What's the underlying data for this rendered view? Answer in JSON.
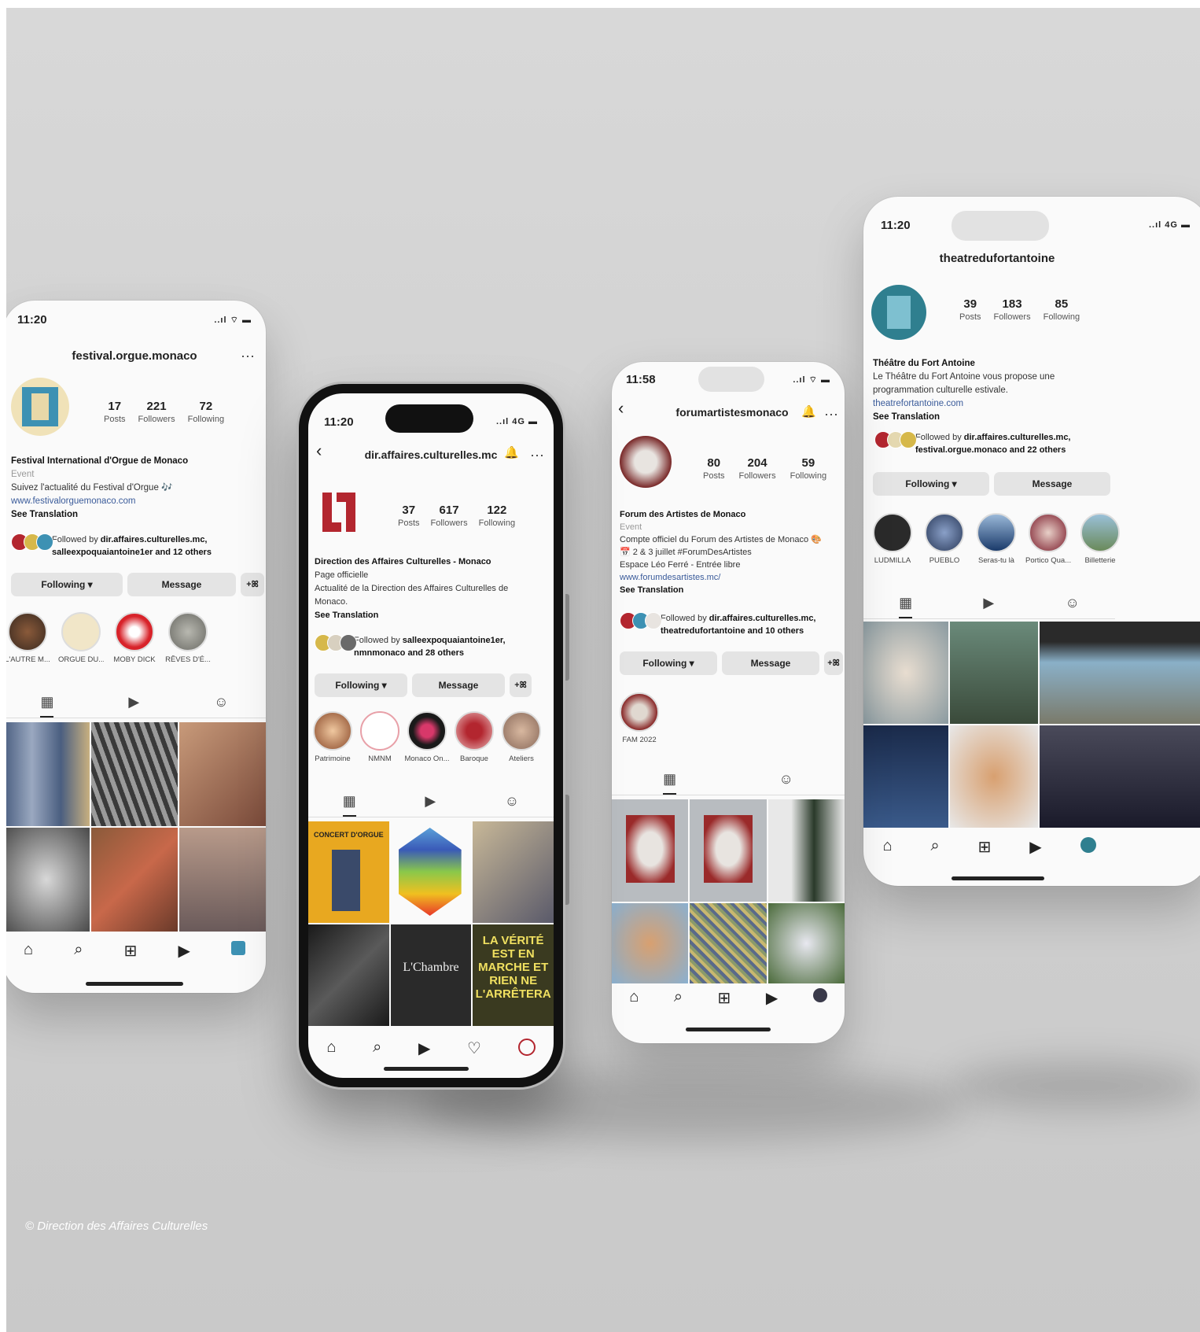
{
  "phones": [
    {
      "time": "11:20",
      "signal": "..ıl ⌔ ▬",
      "username": "festival.orgue.monaco",
      "menu": "···",
      "posts": "17",
      "followers": "221",
      "following": "72",
      "posts_label": "Posts",
      "followers_label": "Followers",
      "following_label": "Following",
      "name": "Festival International d'Orgue de Monaco",
      "category": "Event",
      "bio": "Suivez l'actualité du Festival d'Orgue 🎶",
      "link": "www.festivalorguemonaco.com",
      "see_translation": "See Translation",
      "followed_prefix": "Followed by ",
      "followed_names": "dir.affaires.culturelles.mc,",
      "followed_rest": "salleexpoquaiantoine1er and 12 others",
      "following_btn": "Following ▾",
      "message_btn": "Message",
      "add_btn": "+ꕤ",
      "highlights": [
        "L'AUTRE M...",
        "ORGUE DU...",
        "MOBY DICK",
        "RÊVES D'É..."
      ]
    },
    {
      "time": "11:20",
      "signal": "..ıl 4G ▬",
      "username": "dir.affaires.culturelles.mc",
      "back": "‹",
      "bell": "🔔",
      "menu": "···",
      "posts": "37",
      "followers": "617",
      "following": "122",
      "posts_label": "Posts",
      "followers_label": "Followers",
      "following_label": "Following",
      "name": "Direction des Affaires Culturelles - Monaco",
      "category": "Page officielle",
      "bio": "Actualité de la Direction des Affaires Culturelles de Monaco.",
      "see_translation": "See Translation",
      "followed_prefix": "Followed by ",
      "followed_names": "salleexpoquaiantoine1er,",
      "followed_rest": "nmnmonaco and 28 others",
      "following_btn": "Following ▾",
      "message_btn": "Message",
      "add_btn": "+ꕤ",
      "highlights": [
        "Patrimoine",
        "NMNM",
        "Monaco On...",
        "Baroque",
        "Ateliers"
      ],
      "post_texts": [
        "CONCERT D'ORGUE",
        "L'Chambre",
        "LA VÉRITÉ EST EN MARCHE ET RIEN NE L'ARRÊTERA"
      ]
    },
    {
      "time": "11:58",
      "signal": "..ıl ⌔ ▬",
      "username": "forumartistesmonaco",
      "back": "‹",
      "bell": "🔔",
      "menu": "···",
      "posts": "80",
      "followers": "204",
      "following": "59",
      "posts_label": "Posts",
      "followers_label": "Followers",
      "following_label": "Following",
      "name": "Forum des Artistes de Monaco",
      "category": "Event",
      "bio1": "Compte officiel du Forum des Artistes de Monaco 🎨",
      "bio2": "📅 2 & 3 juillet #ForumDesArtistes",
      "bio3": "Espace Léo Ferré - Entrée libre",
      "link": "www.forumdesartistes.mc/",
      "see_translation": "See Translation",
      "followed_prefix": "Followed by ",
      "followed_names": "dir.affaires.culturelles.mc,",
      "followed_rest": "theatredufortantoine and 10 others",
      "following_btn": "Following ▾",
      "message_btn": "Message",
      "add_btn": "+ꕤ",
      "highlights": [
        "FAM 2022"
      ]
    },
    {
      "time": "11:20",
      "signal": "..ıl 4G ▬",
      "username": "theatredufortantoine",
      "posts": "39",
      "followers": "183",
      "following": "85",
      "posts_label": "Posts",
      "followers_label": "Followers",
      "following_label": "Following",
      "name": "Théâtre du Fort Antoine",
      "bio": "Le Théâtre du Fort Antoine vous propose une programmation culturelle estivale.",
      "link": "theatrefortantoine.com",
      "see_translation": "See Translation",
      "followed_prefix": "Followed by ",
      "followed_names": "dir.affaires.culturelles.mc,",
      "followed_rest": "festival.orgue.monaco and 22 others",
      "following_btn": "Following ▾",
      "message_btn": "Message",
      "highlights": [
        "LUDMILLA",
        "PUEBLO",
        "Seras-tu là",
        "Portico Qua...",
        "Billetterie"
      ]
    }
  ],
  "icons": {
    "grid": "▦",
    "reels": "▶",
    "tagged": "☺",
    "home": "⌂",
    "search": "⌕",
    "add": "⊞",
    "heart": "♡"
  },
  "credit": "© Direction des Affaires Culturelles",
  "colors": {
    "background": "#d4d4d4",
    "brand_red": "#b3262f",
    "accent_teal": "#2f7f8f"
  }
}
